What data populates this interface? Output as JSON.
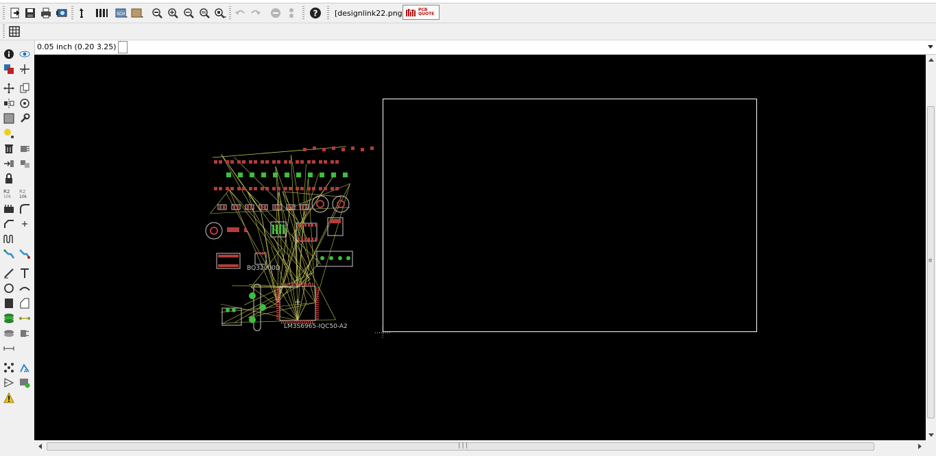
{
  "toolbar": {
    "filename": "[designlink22.png]",
    "pcb_quote": {
      "line1": "PCB",
      "line2": "QUOTE"
    },
    "buttons": [
      "open-icon",
      "save-icon",
      "print-icon",
      "cam-icon",
      "script-icon",
      "ulp-icon",
      "sch-icon",
      "board-icon",
      "zoom-fit-icon",
      "zoom-in-icon",
      "zoom-out-icon",
      "zoom-prev-icon",
      "zoom-select-icon",
      "undo-icon",
      "redo-icon",
      "stop-icon",
      "go-icon",
      "help-icon"
    ]
  },
  "toolbar2": {
    "grid_button": "grid-icon"
  },
  "coord": {
    "readout": "0.05 inch (0.20 3.25)"
  },
  "board": {
    "labels": {
      "mcu": "LM3S6965-IQC50-A2",
      "bq": "BQ32000D"
    },
    "colors": {
      "outline": "#ffffff",
      "airwire": "#c8c85a",
      "pad_green": "#3cbf3c",
      "pad_red": "#b43c3c",
      "silk": "#c8c8c8"
    }
  },
  "colors": {
    "canvas": "#000000",
    "chrome": "#f0f0f0",
    "quote_red": "#b01010"
  }
}
